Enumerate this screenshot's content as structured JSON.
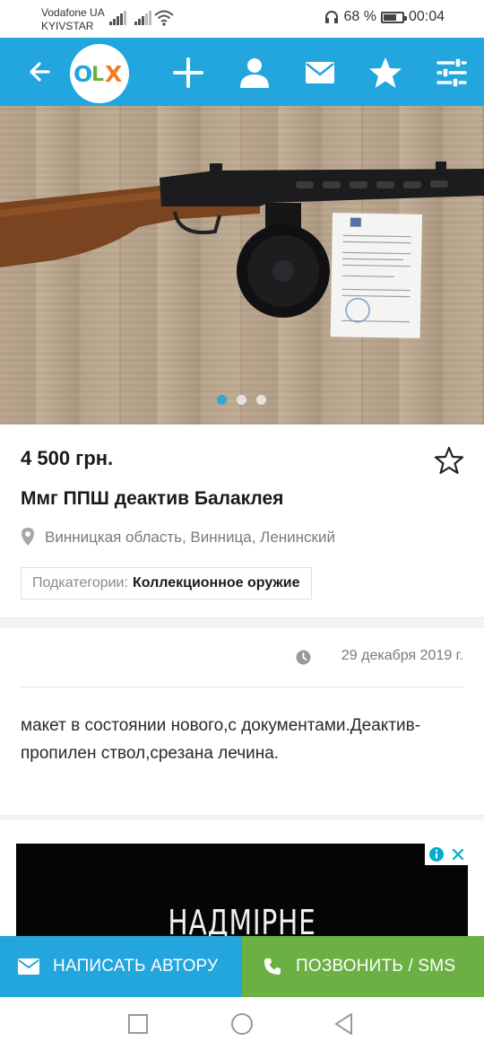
{
  "status_bar": {
    "carrier1": "Vodafone UA",
    "carrier2": "KYIVSTAR",
    "battery_text": "68 %",
    "battery_level": 0.68,
    "time": "00:04",
    "icons": [
      "signal-icon",
      "wifi-icon",
      "headphones-icon",
      "battery-icon"
    ]
  },
  "appbar": {
    "logo_letters": [
      "O",
      "L",
      "X"
    ],
    "colors": {
      "bar": "#23a5dd",
      "logo_o": "#23a5dd",
      "logo_l": "#6cb043",
      "logo_x": "#f07e21"
    },
    "icons": [
      "back-arrow-icon",
      "plus-icon",
      "user-icon",
      "mail-icon",
      "star-icon",
      "settings-sliders-icon"
    ]
  },
  "gallery": {
    "image": "photo of submachine gun with drum magazine and certificate on wooden floor",
    "page_count": 3,
    "active_page": 1
  },
  "listing": {
    "price": "4 500 грн.",
    "title": "Ммг ППШ деактив Балаклея",
    "location": "Винницкая область, Винница, Ленинский",
    "subcategory_label": "Подкатегории:",
    "subcategory_value": "Коллекционное оружие",
    "date": "29 декабря 2019 г.",
    "description": "макет в состоянии нового,с документами.Деактив-пропилен ствол,срезана лечина."
  },
  "ad": {
    "text": "НАДМІРНЕ СПОЖИВАННЯ",
    "icons": [
      "info-icon",
      "close-icon"
    ]
  },
  "actions": {
    "write_label": "НАПИСАТЬ АВТОРУ",
    "call_label": "ПОЗВОНИТЬ / SMS",
    "write_color": "#23a5dd",
    "call_color": "#6cb043"
  },
  "navbar": {
    "icons": [
      "recent-apps-icon",
      "home-icon",
      "back-icon"
    ]
  }
}
